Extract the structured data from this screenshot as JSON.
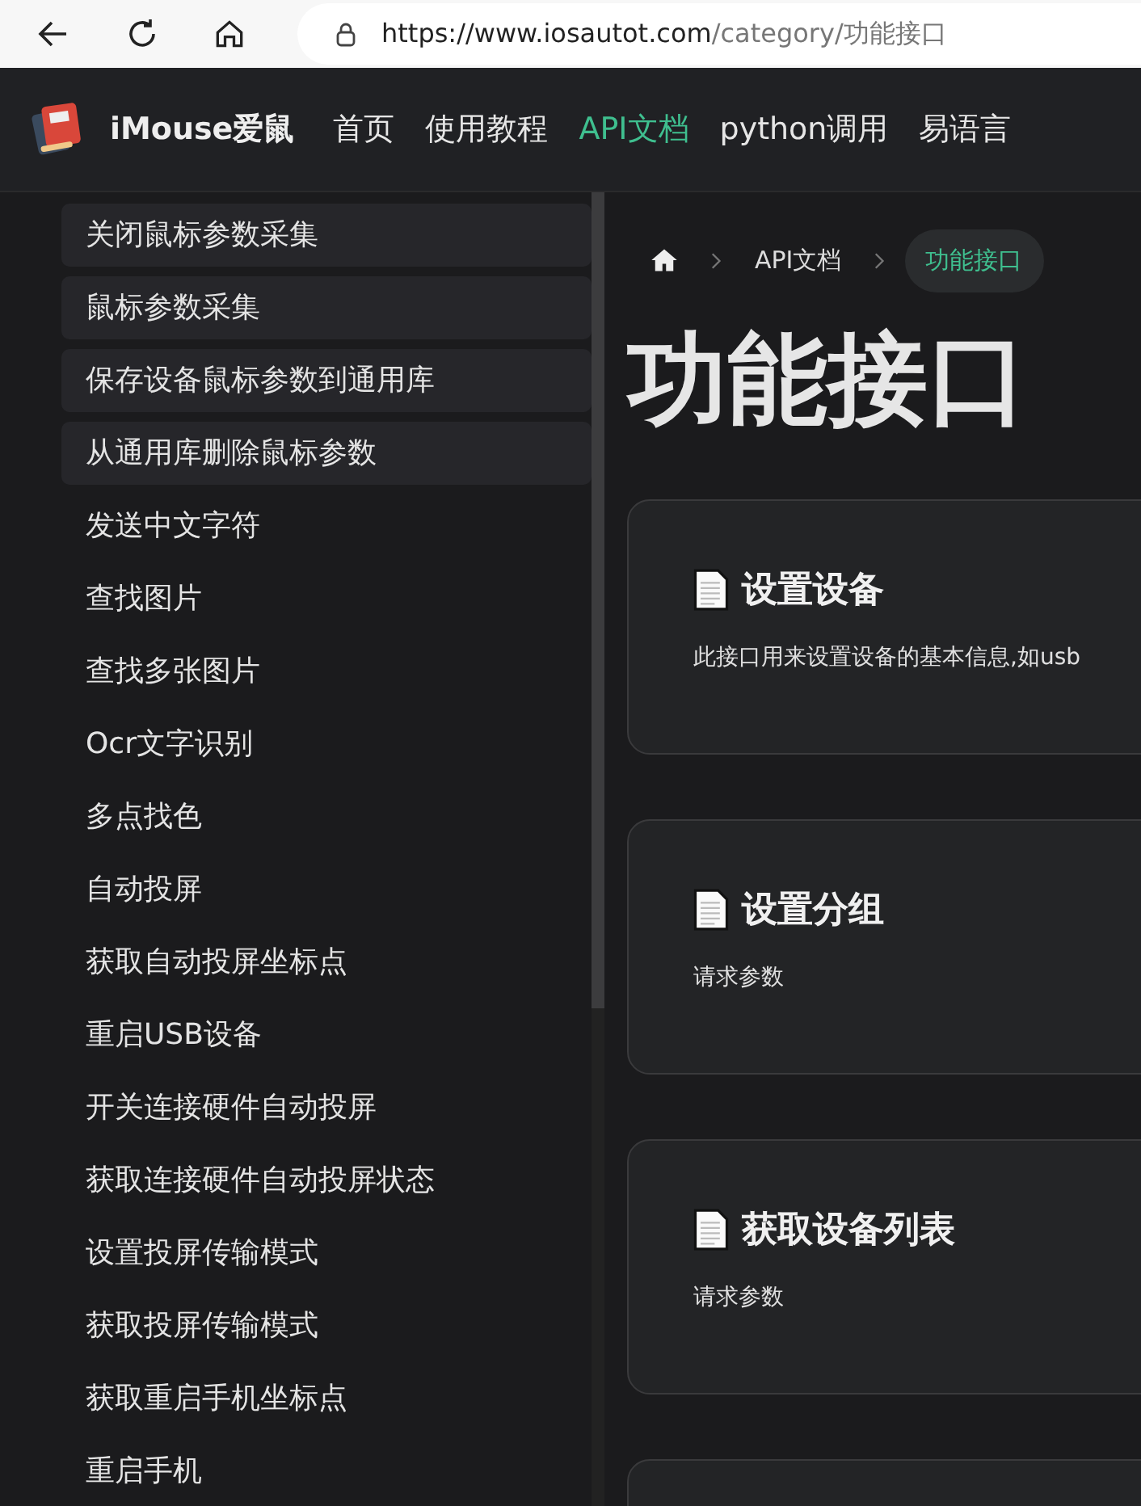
{
  "browser": {
    "url_host": "https://www.iosautot.com",
    "url_path": "/category/功能接口"
  },
  "site": {
    "name": "iMouse爱鼠",
    "nav": [
      {
        "label": "首页",
        "selected": false
      },
      {
        "label": "使用教程",
        "selected": false
      },
      {
        "label": "API文档",
        "selected": true
      },
      {
        "label": "python调用",
        "selected": false
      },
      {
        "label": "易语言",
        "selected": false
      }
    ]
  },
  "sidebar": {
    "items": [
      {
        "label": "关闭鼠标参数采集",
        "highlighted": true
      },
      {
        "label": "鼠标参数采集",
        "highlighted": true
      },
      {
        "label": "保存设备鼠标参数到通用库",
        "highlighted": true
      },
      {
        "label": "从通用库删除鼠标参数",
        "highlighted": true
      },
      {
        "label": "发送中文字符",
        "highlighted": false
      },
      {
        "label": "查找图片",
        "highlighted": false
      },
      {
        "label": "查找多张图片",
        "highlighted": false
      },
      {
        "label": "Ocr文字识别",
        "highlighted": false
      },
      {
        "label": "多点找色",
        "highlighted": false
      },
      {
        "label": "自动投屏",
        "highlighted": false
      },
      {
        "label": "获取自动投屏坐标点",
        "highlighted": false
      },
      {
        "label": "重启USB设备",
        "highlighted": false
      },
      {
        "label": "开关连接硬件自动投屏",
        "highlighted": false
      },
      {
        "label": "获取连接硬件自动投屏状态",
        "highlighted": false
      },
      {
        "label": "设置投屏传输模式",
        "highlighted": false
      },
      {
        "label": "获取投屏传输模式",
        "highlighted": false
      },
      {
        "label": "获取重启手机坐标点",
        "highlighted": false
      },
      {
        "label": "重启手机",
        "highlighted": false
      }
    ]
  },
  "breadcrumb": [
    {
      "label": "API文档",
      "selected": false
    },
    {
      "label": "功能接口",
      "selected": true
    }
  ],
  "page_title": "功能接口",
  "cards": [
    {
      "kind": "entry",
      "title": "设置设备",
      "text": "此接口用来设置设备的基本信息,如usb"
    },
    {
      "kind": "entry",
      "title": "设置分组",
      "text": "请求参数"
    },
    {
      "kind": "entry",
      "title": "获取设备列表",
      "text": "请求参数"
    },
    {
      "kind": "cut"
    }
  ]
}
